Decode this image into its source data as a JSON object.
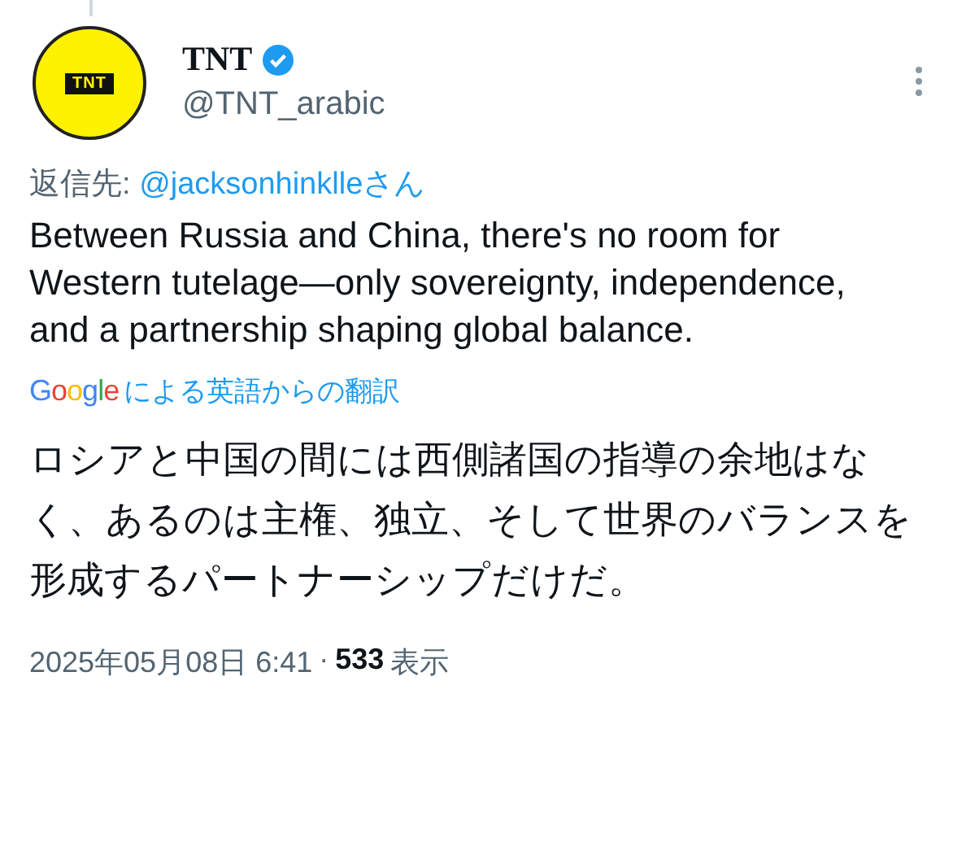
{
  "author": {
    "name": "TNT",
    "verified": true,
    "handle": "@TNT_arabic",
    "avatar_text": "TNT"
  },
  "reply_to": {
    "label": "返信先:",
    "user": "@jacksonhinklleさん"
  },
  "body": "Between Russia and China, there's no room for Western tutelage—only sovereignty, independence, and a partnership shaping global balance.",
  "translation": {
    "brand": "Google",
    "label": "による英語からの翻訳",
    "text": "ロシアと中国の間には西側諸国の指導の余地はなく、あるのは主権、独立、そして世界のバランスを形成するパートナーシップだけだ。"
  },
  "meta": {
    "timestamp": "2025年05月08日 6:41",
    "separator": "·",
    "views": "533",
    "views_label": "表示"
  }
}
